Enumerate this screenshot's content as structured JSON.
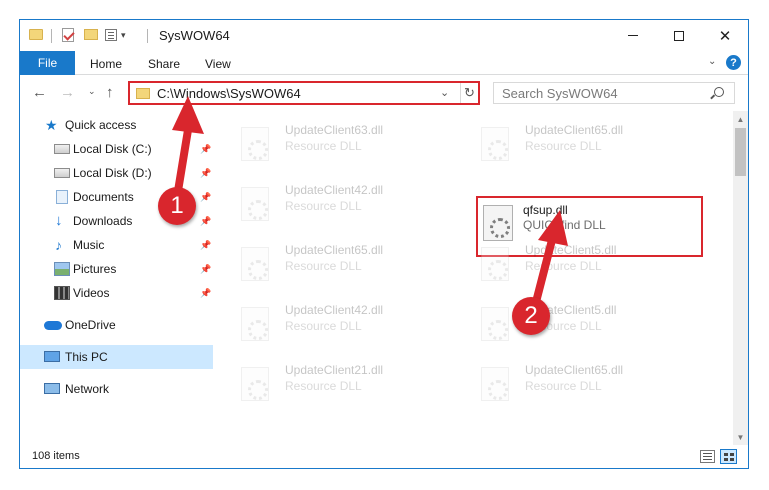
{
  "window": {
    "title": "SysWOW64",
    "minimize_glyph": "",
    "close_glyph": "✕"
  },
  "ribbon": {
    "tabs": [
      "File",
      "Home",
      "Share",
      "View"
    ],
    "expand_glyph": "⌄",
    "help_glyph": "?"
  },
  "nav": {
    "back_glyph": "←",
    "forward_glyph": "→",
    "recent_glyph": "⌄",
    "up_glyph": "↑"
  },
  "address": {
    "path": "C:\\Windows\\SysWOW64",
    "dropdown_glyph": "⌄",
    "refresh_glyph": "↻"
  },
  "search": {
    "placeholder": "Search SysWOW64"
  },
  "navpane": {
    "items": [
      {
        "label": "Quick access",
        "icon": "star-icon",
        "pinned": false
      },
      {
        "label": "Local Disk (C:)",
        "icon": "disk-icon",
        "pinned": true
      },
      {
        "label": "Local Disk (D:)",
        "icon": "disk-icon",
        "pinned": true
      },
      {
        "label": "Documents",
        "icon": "documents-icon",
        "pinned": true
      },
      {
        "label": "Downloads",
        "icon": "downloads-icon",
        "pinned": true
      },
      {
        "label": "Music",
        "icon": "music-icon",
        "pinned": true
      },
      {
        "label": "Pictures",
        "icon": "pictures-icon",
        "pinned": true
      },
      {
        "label": "Videos",
        "icon": "videos-icon",
        "pinned": true
      },
      {
        "label": "OneDrive",
        "icon": "onedrive-icon",
        "pinned": false
      },
      {
        "label": "This PC",
        "icon": "this-pc-icon",
        "pinned": false,
        "selected": true
      },
      {
        "label": "Network",
        "icon": "network-icon",
        "pinned": false
      }
    ],
    "pin_glyph": "📌"
  },
  "files": {
    "left": [
      {
        "name": "UpdateClient63.dll",
        "type": "Resource DLL"
      },
      {
        "name": "UpdateClient42.dll",
        "type": "Resource DLL"
      },
      {
        "name": "UpdateClient65.dll",
        "type": "Resource DLL"
      },
      {
        "name": "UpdateClient42.dll",
        "type": "Resource DLL"
      },
      {
        "name": "UpdateClient21.dll",
        "type": "Resource DLL"
      }
    ],
    "right": [
      {
        "name": "UpdateClient65.dll",
        "type": "Resource DLL"
      },
      {
        "name": "qfsup.dll",
        "type": "QUICKfind DLL",
        "highlighted": true
      },
      {
        "name": "UpdateClient5.dll",
        "type": "Resource DLL"
      },
      {
        "name": "UpdateClient5.dll",
        "type": "Resource DLL"
      },
      {
        "name": "UpdateClient65.dll",
        "type": "Resource DLL"
      }
    ]
  },
  "scrollbar": {
    "up_glyph": "▲",
    "down_glyph": "▼"
  },
  "status": {
    "item_count": "108 items"
  },
  "annotations": {
    "badge_1": "1",
    "badge_2": "2",
    "color": "#d9262d"
  },
  "colors": {
    "accent": "#1979ca",
    "selection": "#cce8ff",
    "highlight_border": "#d9262d"
  }
}
